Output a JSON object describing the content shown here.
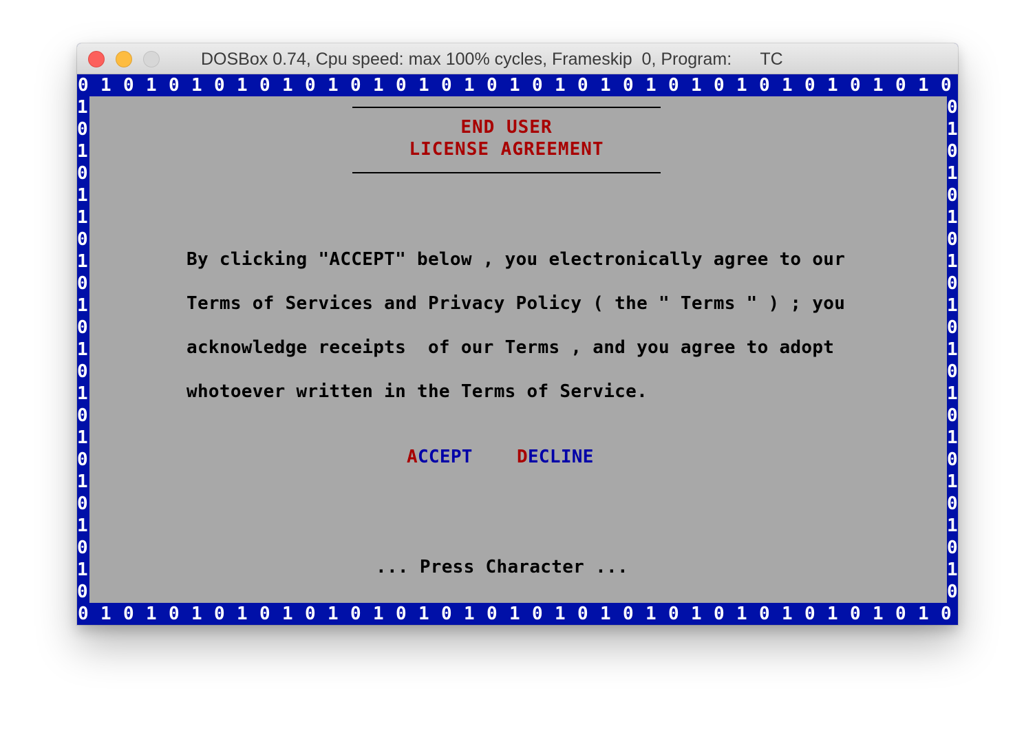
{
  "window": {
    "title": "DOSBox 0.74, Cpu speed: max 100% cycles, Frameskip  0, Program:      TC",
    "controls": [
      "close",
      "minimize",
      "zoom"
    ]
  },
  "border": {
    "top": "0 1 0 1 0 1 0 1 0 1 0 1 0 1 0 1 0 1 0 1 0 1 0 1 0 1 0 1 0 1 0 1 0 1 0 1 0 1 0 1",
    "bottom": "0 1 0 1 0 1 0 1 0 1 0 1 0 1 0 1 0 1 0 1 0 1 0 1 0 1 0 1 0 1 0 1 0 1 0 1 0 1 0 1",
    "left": [
      "1",
      "0",
      "1",
      "0",
      "1",
      "1",
      "0",
      "1",
      "0",
      "1",
      "0",
      "1",
      "0",
      "1",
      "0",
      "1",
      "0",
      "1",
      "0",
      "1",
      "0",
      "1",
      "0"
    ],
    "right": [
      "0",
      "1",
      "0",
      "1",
      "0",
      "1",
      "0",
      "1",
      "0",
      "1",
      "0",
      "1",
      "0",
      "1",
      "0",
      "1",
      "0",
      "1",
      "0",
      "1",
      "0",
      "1",
      "0"
    ]
  },
  "agreement": {
    "heading_line1": "END USER",
    "heading_line2": "LICENSE AGREEMENT",
    "body": [
      "By clicking \"ACCEPT\" below , you electronically agree to our",
      "Terms of Services and Privacy Policy ( the \" Terms \" ) ; you",
      "acknowledge receipts  of our Terms , and you agree to adopt",
      "whotoever written in the Terms of Service."
    ]
  },
  "buttons": {
    "accept": {
      "hotkey": "A",
      "rest": "CCEPT"
    },
    "decline": {
      "hotkey": "D",
      "rest": "ECLINE"
    }
  },
  "prompt": "... Press Character ...",
  "colors": {
    "dos_blue": "#0010a8",
    "dos_gray": "#a8a8a8",
    "dos_red": "#a80000",
    "dos_button_blue": "#0000a8"
  }
}
